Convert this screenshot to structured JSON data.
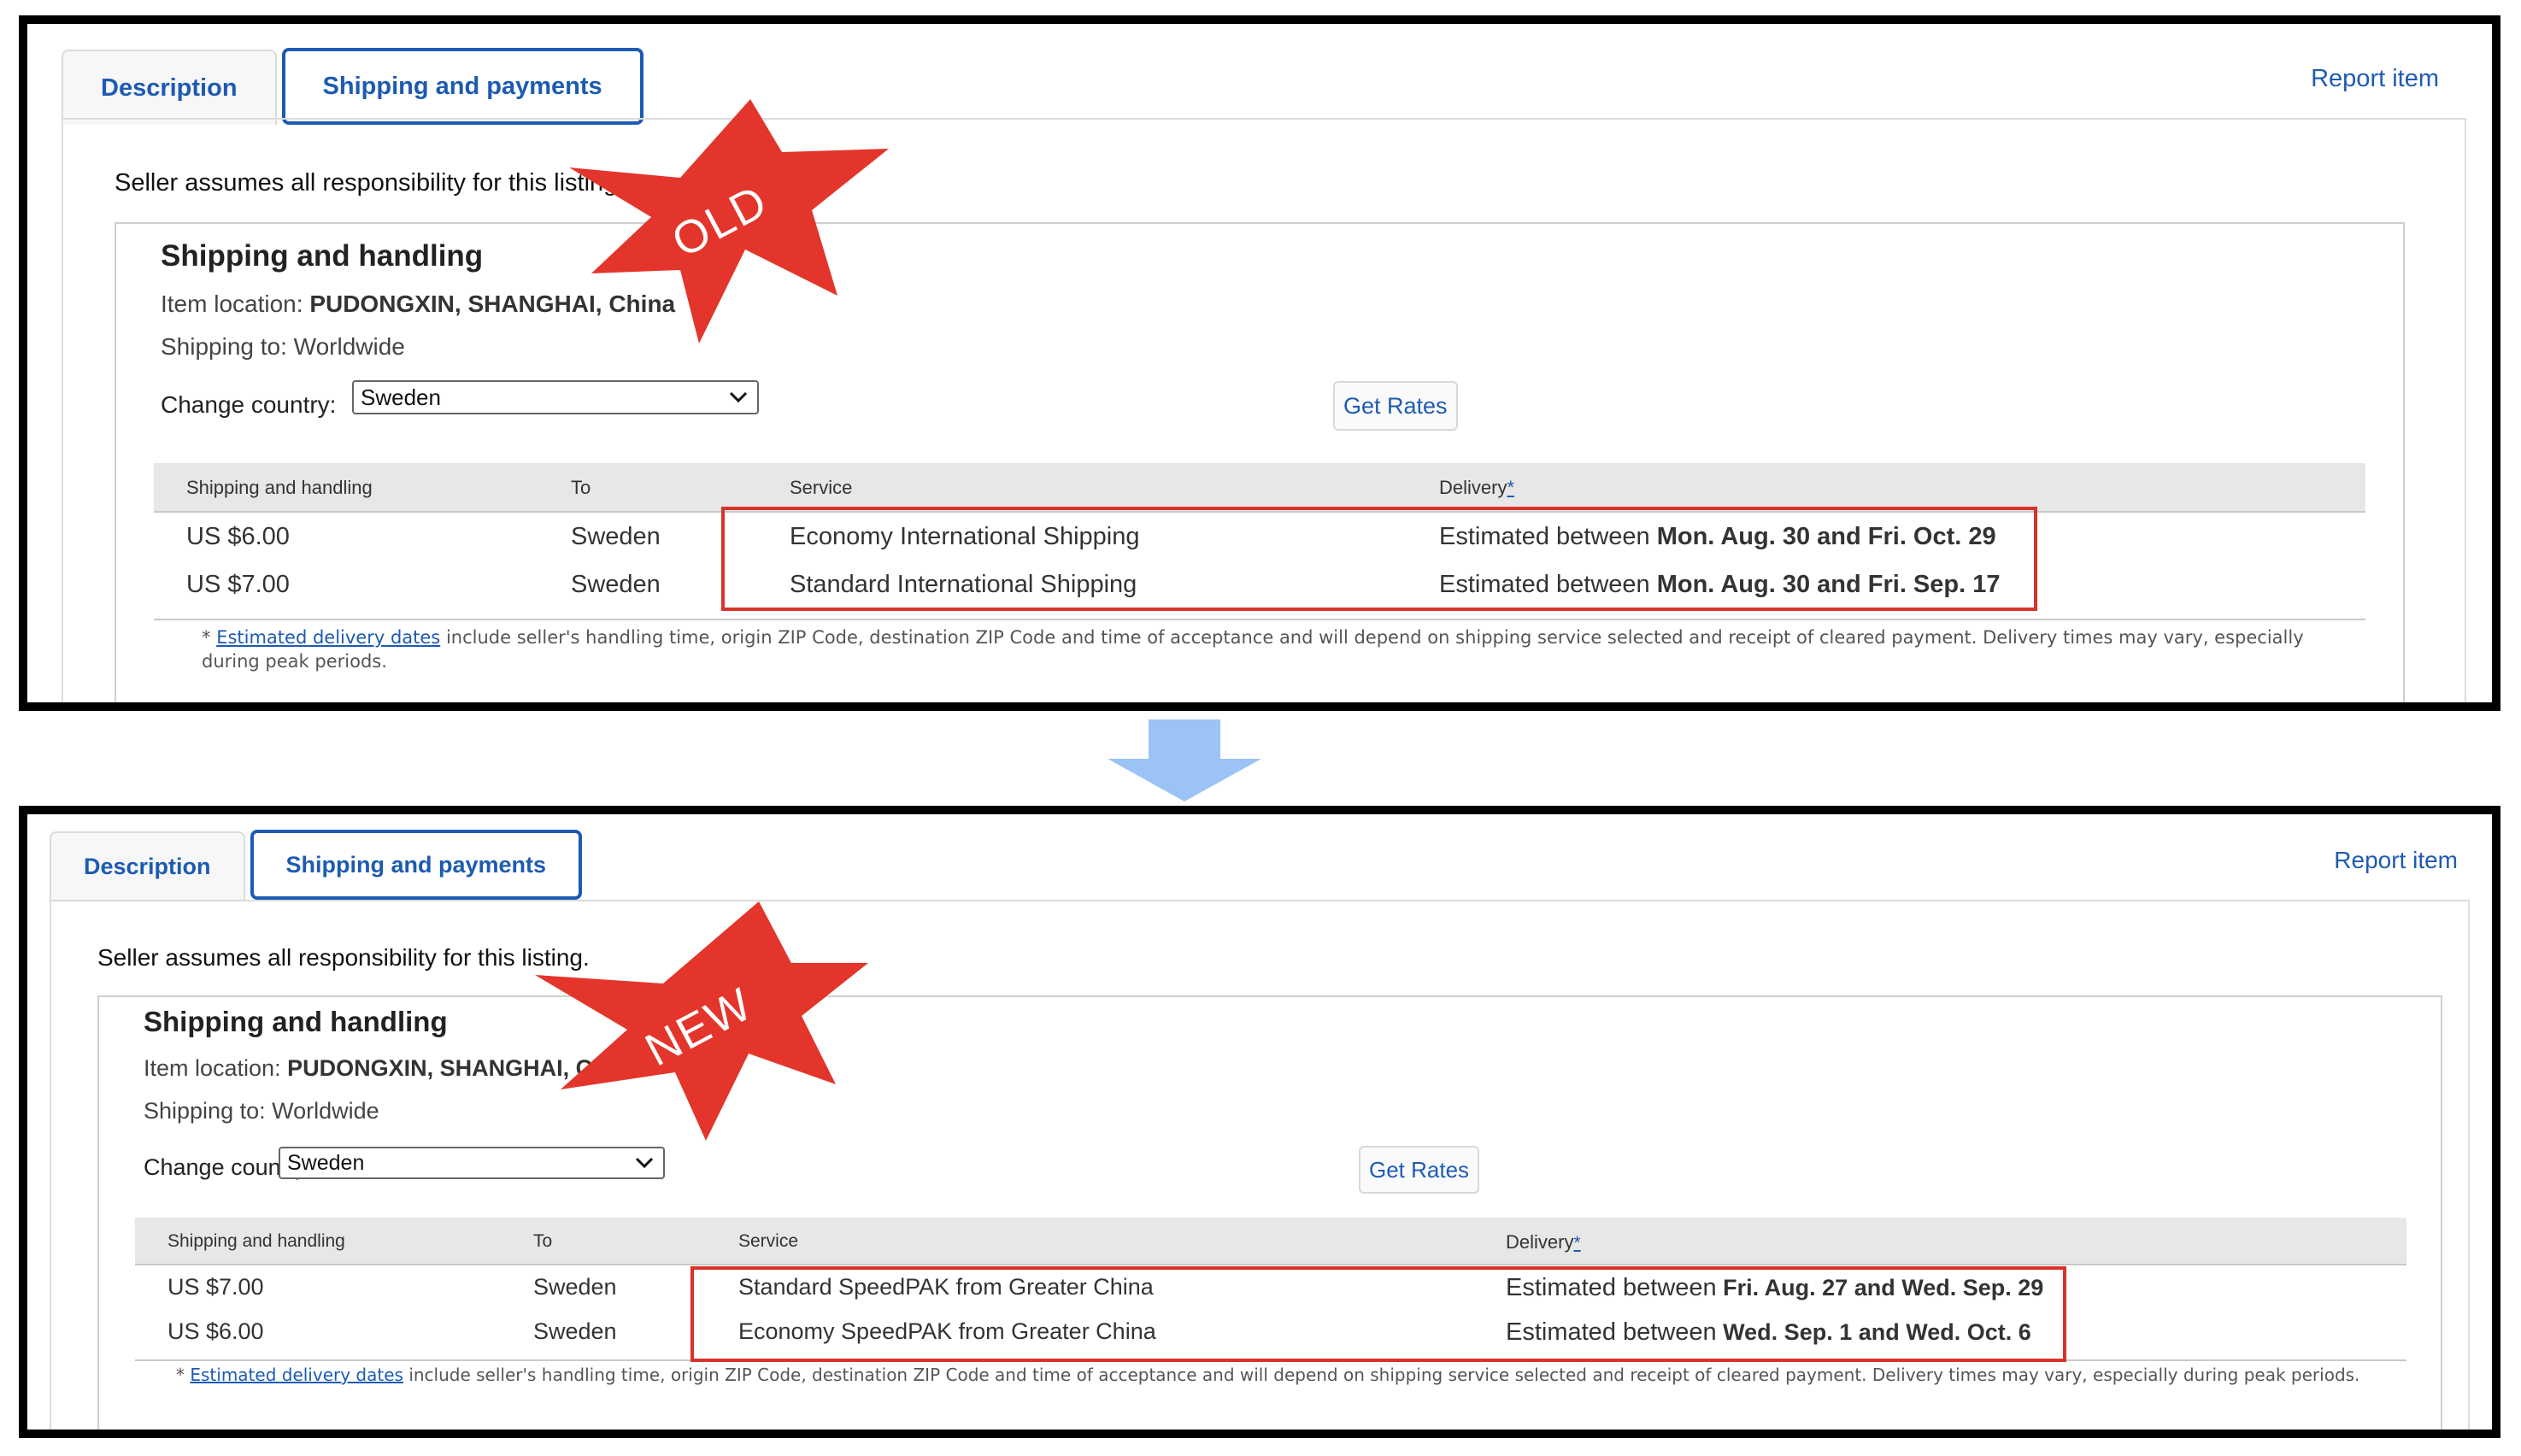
{
  "old": {
    "badge": "OLD",
    "tabs": [
      {
        "label": "Description"
      },
      {
        "label": "Shipping and payments"
      }
    ],
    "report_label": "Report item",
    "responsibility": "Seller assumes all responsibility for this listing.",
    "title": "Shipping and handling",
    "item_location_label": "Item location:",
    "item_location_value": "PUDONGXIN, SHANGHAI, China",
    "shipping_to": "Shipping to: Worldwide",
    "change_country_label": "Change country:",
    "country_value": "Sweden",
    "get_rates_label": "Get Rates",
    "columns": [
      "Shipping and handling",
      "To",
      "Service",
      "Delivery",
      "*"
    ],
    "rows": [
      {
        "price": "US $6.00",
        "to": "Sweden",
        "service": "Economy International Shipping",
        "delivery_prefix": "Estimated between",
        "delivery_dates": "Mon. Aug. 30 and Fri. Oct. 29"
      },
      {
        "price": "US $7.00",
        "to": "Sweden",
        "service": "Standard International Shipping",
        "delivery_prefix": "Estimated between",
        "delivery_dates": "Mon. Aug. 30 and Fri. Sep. 17"
      }
    ],
    "footnote_star": "*",
    "footnote_link": "Estimated delivery dates",
    "footnote_line1": "include seller's handling time, origin ZIP Code, destination ZIP Code and time of acceptance and will depend on shipping service selected and receipt of cleared payment. Delivery times may vary, especially",
    "footnote_line2": "during peak periods."
  },
  "new": {
    "badge": "NEW",
    "tabs": [
      {
        "label": "Description"
      },
      {
        "label": "Shipping and payments"
      }
    ],
    "report_label": "Report item",
    "responsibility": "Seller assumes all responsibility for this listing.",
    "title": "Shipping and handling",
    "item_location_label": "Item location:",
    "item_location_value": "PUDONGXIN, SHANGHAI, China",
    "shipping_to": "Shipping to: Worldwide",
    "change_country_label": "Change country:",
    "country_value": "Sweden",
    "get_rates_label": "Get Rates",
    "columns": [
      "Shipping and handling",
      "To",
      "Service",
      "Delivery",
      "*"
    ],
    "rows": [
      {
        "price": "US $7.00",
        "to": "Sweden",
        "service": "Standard SpeedPAK from Greater China",
        "delivery_prefix": "Estimated between",
        "delivery_dates": "Fri. Aug. 27 and Wed. Sep. 29"
      },
      {
        "price": "US $6.00",
        "to": "Sweden",
        "service": "Economy SpeedPAK from Greater China",
        "delivery_prefix": "Estimated between",
        "delivery_dates": "Wed. Sep. 1 and Wed. Oct. 6"
      }
    ],
    "footnote_star": "*",
    "footnote_link": "Estimated delivery dates",
    "footnote_line1": "include seller's handling time, origin ZIP Code, destination ZIP Code and time of acceptance and will depend on shipping service selected and receipt of cleared payment. Delivery times may vary, especially during peak periods."
  },
  "colors": {
    "accent": "#1d5bb2",
    "badge": "#e3352b",
    "highlight": "#d8332a",
    "arrow": "#9cc3f5"
  },
  "icons": {
    "arrow": "down-arrow-icon",
    "select": "chevron-down-icon",
    "badge": "starburst-badge-icon"
  }
}
